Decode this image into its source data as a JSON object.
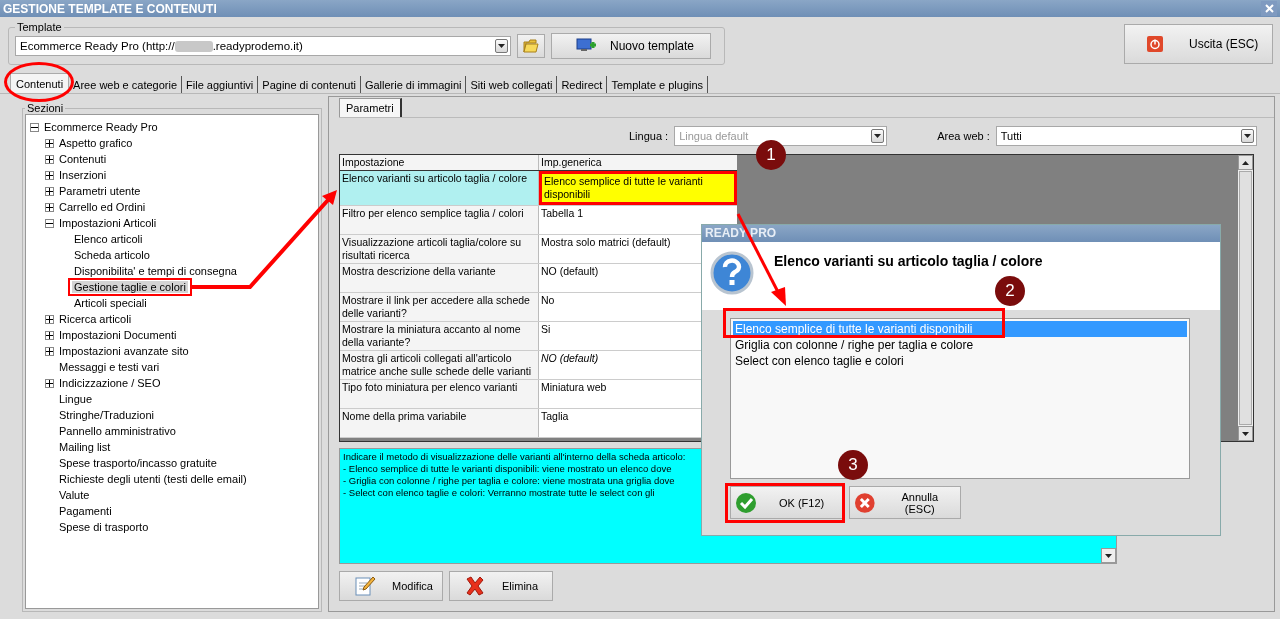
{
  "window": {
    "title": "GESTIONE TEMPLATE E CONTENUTI"
  },
  "template": {
    "label": "Template",
    "value_start": "Ecommerce Ready Pro (http://",
    "value_end": ".readyprodemo.it)",
    "new_button": "Nuovo template"
  },
  "exit_button": "Uscita (ESC)",
  "tabs": [
    {
      "label": "Contenuti",
      "selected": true
    },
    {
      "label": "Aree web e categorie",
      "selected": false
    },
    {
      "label": "File aggiuntivi",
      "selected": false
    },
    {
      "label": "Pagine di contenuti",
      "selected": false
    },
    {
      "label": "Gallerie di immagini",
      "selected": false
    },
    {
      "label": "Siti web collegati",
      "selected": false
    },
    {
      "label": "Redirect",
      "selected": false
    },
    {
      "label": "Template e plugins",
      "selected": false
    }
  ],
  "sections": {
    "label": "Sezioni",
    "tree": [
      {
        "label": "Ecommerce Ready Pro",
        "expanded": true,
        "selected": false,
        "children": [
          {
            "label": "Aspetto grafico",
            "expanded": false,
            "selected": false
          },
          {
            "label": "Contenuti",
            "expanded": false,
            "selected": false
          },
          {
            "label": "Inserzioni",
            "expanded": false,
            "selected": false
          },
          {
            "label": "Parametri utente",
            "expanded": false,
            "selected": false
          },
          {
            "label": "Carrello ed Ordini",
            "expanded": false,
            "selected": false
          },
          {
            "label": "Impostazioni Articoli",
            "expanded": true,
            "selected": false,
            "children": [
              {
                "label": "Elenco articoli",
                "selected": false
              },
              {
                "label": "Scheda articolo",
                "selected": false
              },
              {
                "label": "Disponibilita' e tempi di consegna",
                "selected": false
              },
              {
                "label": "Gestione taglie e colori",
                "selected": true
              },
              {
                "label": "Articoli speciali",
                "selected": false
              }
            ]
          },
          {
            "label": "Ricerca articoli",
            "expanded": false,
            "selected": false
          },
          {
            "label": "Impostazioni Documenti",
            "expanded": false,
            "selected": false
          },
          {
            "label": "Impostazioni avanzate sito",
            "expanded": false,
            "selected": false
          },
          {
            "label": "Messaggi e testi vari",
            "selected": false
          },
          {
            "label": "Indicizzazione / SEO",
            "expanded": false,
            "selected": false
          },
          {
            "label": "Lingue",
            "selected": false
          },
          {
            "label": "Stringhe/Traduzioni",
            "selected": false
          },
          {
            "label": "Pannello amministrativo",
            "selected": false
          },
          {
            "label": "Mailing list",
            "selected": false
          },
          {
            "label": "Spese trasporto/incasso gratuite",
            "selected": false
          },
          {
            "label": "Richieste degli utenti (testi delle email)",
            "selected": false
          },
          {
            "label": "Valute",
            "selected": false
          },
          {
            "label": "Pagamenti",
            "selected": false
          },
          {
            "label": "Spese di trasporto",
            "selected": false
          }
        ]
      }
    ]
  },
  "params_tab": {
    "label": "Parametri",
    "selected": true
  },
  "filters": {
    "language_label": "Lingua :",
    "language_value": "Lingua default",
    "language_disabled": true,
    "area_label": "Area web :",
    "area_value": "Tutti"
  },
  "table": {
    "columns": [
      "Impostazione",
      "Imp.generica"
    ],
    "rows": [
      {
        "setting": "Elenco varianti su articolo taglia / colore",
        "value": "Elenco semplice di tutte le varianti disponibili",
        "selected": true,
        "italic": false
      },
      {
        "setting": "Filtro per elenco semplice taglia / colori",
        "value": "Tabella 1",
        "selected": false,
        "italic": false
      },
      {
        "setting": "Visualizzazione articoli taglia/colore su risultati ricerca",
        "value": "Mostra solo matrici (default)",
        "selected": false,
        "italic": false
      },
      {
        "setting": "Mostra descrizione della variante",
        "value": "NO (default)",
        "selected": false,
        "italic": false
      },
      {
        "setting": "Mostrare il link per accedere alla schede delle varianti?",
        "value": "No",
        "selected": false,
        "italic": false
      },
      {
        "setting": "Mostrare la miniatura accanto al nome della variante?",
        "value": "Si",
        "selected": false,
        "italic": false
      },
      {
        "setting": "Mostra gli articoli collegati all'articolo matrice anche sulle schede delle varianti",
        "value": "NO (default)",
        "selected": false,
        "italic": true
      },
      {
        "setting": "Tipo foto miniatura per elenco varianti",
        "value": "Miniatura web",
        "selected": false,
        "italic": false
      },
      {
        "setting": "Nome della prima variabile",
        "value": "Taglia",
        "selected": false,
        "italic": false
      }
    ]
  },
  "description": [
    "Indicare il metodo di visualizzazione delle varianti all'interno della scheda articolo:",
    "- Elenco semplice di tutte le varianti disponibili: viene mostrato un elenco dove",
    "- Griglia con colonne / righe per taglia e colore: viene mostrata una griglia dove",
    "- Select con elenco taglie e colori: Verranno mostrate tutte le select con gli"
  ],
  "actions": [
    "Modifica",
    "Elimina"
  ],
  "dialog": {
    "title": "READY PRO",
    "heading": "Elenco varianti su articolo taglia / colore",
    "options": [
      {
        "label": "Elenco semplice di tutte le varianti disponibili",
        "selected": true
      },
      {
        "label": "Griglia con colonne / righe per taglia e colore",
        "selected": false
      },
      {
        "label": "Select con elenco taglie e colori",
        "selected": false
      }
    ],
    "ok": "OK (F12)",
    "cancel": "Annulla (ESC)"
  },
  "badges": [
    "1",
    "2",
    "3"
  ]
}
